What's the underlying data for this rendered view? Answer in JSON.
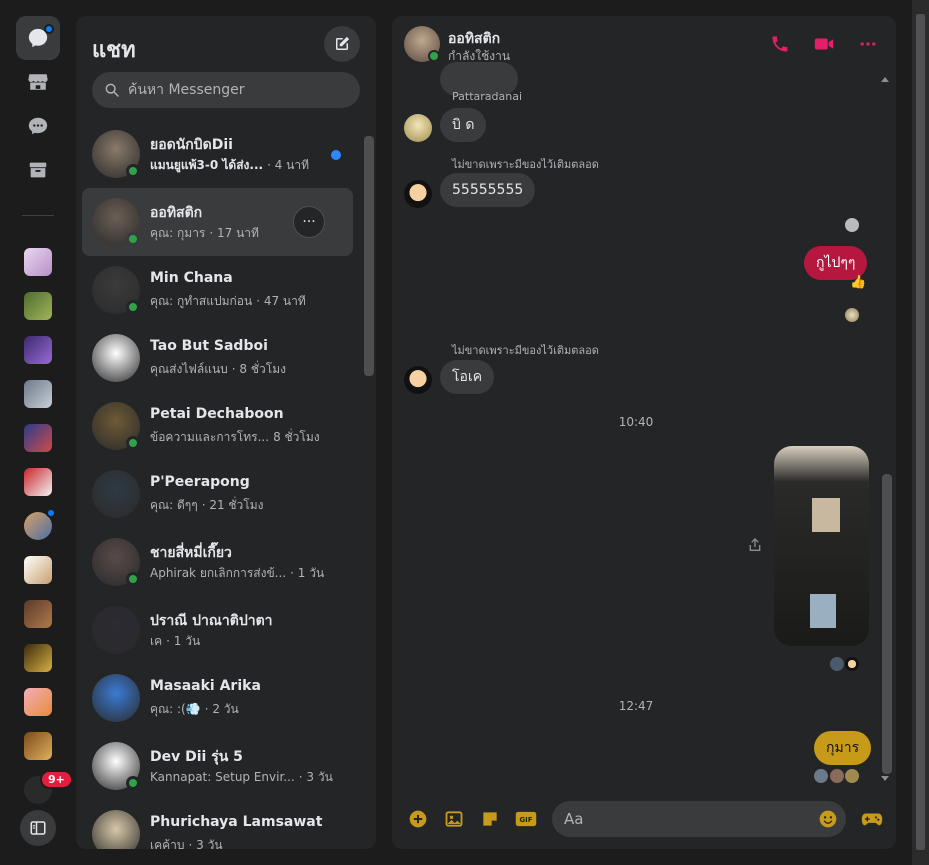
{
  "rail": {
    "icons": [
      "chat-bubble-icon",
      "store-icon",
      "message-request-icon",
      "archive-icon",
      "sidebar-toggle-icon"
    ],
    "badge_count": "9+"
  },
  "chatlist": {
    "title": "แชท",
    "search_placeholder": "ค้นหา Messenger",
    "conversations": [
      {
        "name": "ยอดนักบิดDii",
        "snippet": "แมนยูแพ้3-0 ได้ส่ง...",
        "time": "· 4 นาที",
        "unread": true,
        "online": true,
        "color": "#8a7a6a"
      },
      {
        "name": "ออทิสติก",
        "snippet": "คุณ: กุมาร",
        "time": "· 17 นาที",
        "unread": false,
        "online": true,
        "color": "#6b5f55"
      },
      {
        "name": "Min Chana",
        "snippet": "คุณ: กูทำสแปมก่อน",
        "time": "· 47 นาที",
        "unread": false,
        "online": true,
        "color": "#3b3b3b"
      },
      {
        "name": "Tao But Sadboi",
        "snippet": "คุณส่งไฟล์แนบ",
        "time": "· 8 ชั่วโมง",
        "unread": false,
        "online": false,
        "color": "#ffffff"
      },
      {
        "name": "Petai Dechaboon",
        "snippet": "ข้อความและการโทร...",
        "time": "8 ชั่วโมง",
        "unread": false,
        "online": true,
        "color": "#6e5a36"
      },
      {
        "name": "P'Peerapong",
        "snippet": "คุณ: ดีๆๆ",
        "time": "· 21 ชั่วโมง",
        "unread": false,
        "online": false,
        "color": "#2f3a44"
      },
      {
        "name": "ชายสี่หมี่เกี๊ยว",
        "snippet": "Aphirak ยกเลิกการส่งข้...",
        "time": "· 1 วัน",
        "unread": false,
        "online": true,
        "color": "#5a4a4a"
      },
      {
        "name": "ปราณี ปาณาติปาตา",
        "snippet": "เค",
        "time": "· 1 วัน",
        "unread": false,
        "online": false,
        "color": "#2c2a33"
      },
      {
        "name": "Masaaki Arika",
        "snippet": "คุณ: :(💨",
        "time": "· 2 วัน",
        "unread": false,
        "online": false,
        "color": "#3a7bd5"
      },
      {
        "name": "Dev Dii รุ่น 5",
        "snippet": "Kannapat: Setup Envir...",
        "time": "· 3 วัน",
        "unread": false,
        "online": true,
        "color": "#ffffff"
      },
      {
        "name": "Phurichaya Lamsawat",
        "snippet": "เคค้าบ",
        "time": "· 3 วัน",
        "unread": false,
        "online": false,
        "color": "#d8c8a8"
      }
    ]
  },
  "chat": {
    "name": "ออทิสติก",
    "status": "กำลังใช้งาน",
    "accent": "#e41e6a",
    "messages": {
      "sender1": "Pattaradanai",
      "msg1": "บิ ด",
      "sender2": "ไม่ขาดเพราะมีของไว้เติมตลอด",
      "msg2": "55555555",
      "msg3": "กูไปๆๆ",
      "msg3_reaction": "👍",
      "sender3": "ไม่ขาดเพราะมีของไว้เติมตลอด",
      "msg4": "โอเค",
      "time1": "10:40",
      "time2": "12:47",
      "msg5": "กุมาร"
    },
    "composer_placeholder": "Aa"
  },
  "colors": {
    "sent_bubble_red": "#b5173f",
    "sent_bubble_gold": "#c79a1a",
    "received_bubble": "#3a3b3c",
    "online": "#31a24c"
  }
}
